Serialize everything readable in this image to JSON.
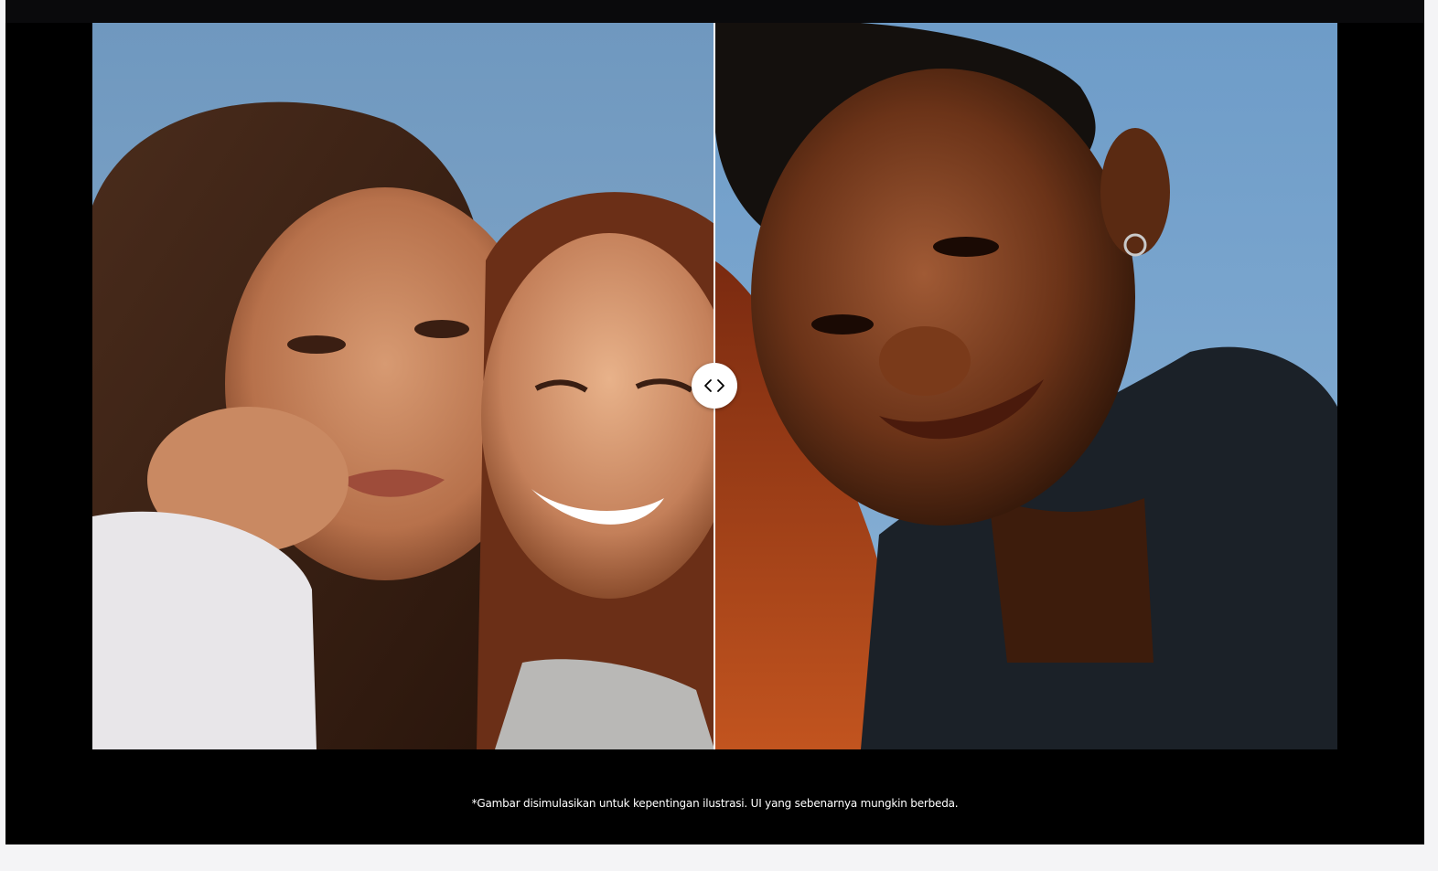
{
  "comparison": {
    "before_label": "",
    "after_label": "",
    "handle_icon": "chevron-left-right-icon"
  },
  "disclaimer": "*Gambar disimulasikan untuk kepentingan ilustrasi. UI yang sebenarnya mungkin berbeda.",
  "colors": {
    "background": "#000000",
    "sky": "#7aa3c8",
    "divider": "#ffffff",
    "caption_text": "#ffffff",
    "footer_bg": "#f4f4f6"
  }
}
